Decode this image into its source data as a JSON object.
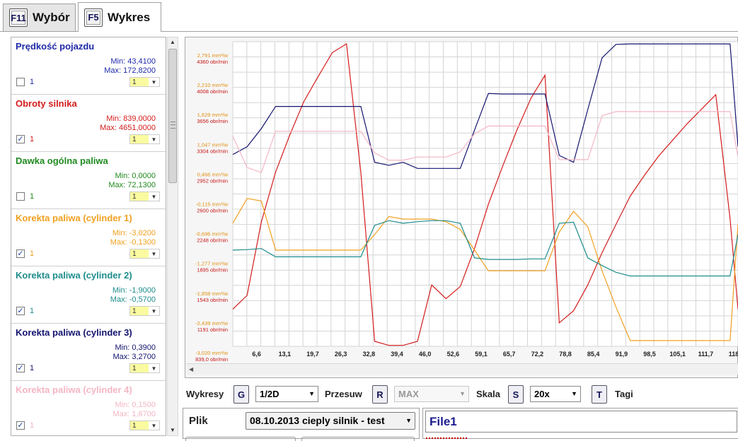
{
  "tabs": [
    {
      "key": "F11",
      "label": "Wybór",
      "active": false
    },
    {
      "key": "F5",
      "label": "Wykres",
      "active": true
    }
  ],
  "channels": [
    {
      "name": "Prędkość pojazdu",
      "color": "#1f2aa8",
      "min": "Min: 43,4100",
      "max": "Max: 172,8200",
      "checked": false,
      "check_label": "1",
      "select": "1"
    },
    {
      "name": "Obroty silnika",
      "color": "#d41c1c",
      "min": "Min: 839,0000",
      "max": "Max: 4651,0000",
      "checked": true,
      "check_label": "1",
      "select": "1"
    },
    {
      "name": "Dawka ogólna paliwa",
      "color": "#1f8a1f",
      "min": "Min: 0,0000",
      "max": "Max: 72,1300",
      "checked": false,
      "check_label": "1",
      "select": "1"
    },
    {
      "name": "Korekta paliwa (cylinder 1)",
      "color": "#f0a020",
      "min": "Min: -3,0200",
      "max": "Max: -0,1300",
      "checked": true,
      "check_label": "1",
      "select": "1"
    },
    {
      "name": "Korekta paliwa (cylinder 2)",
      "color": "#1e8c8c",
      "min": "Min: -1,9000",
      "max": "Max: -0,5700",
      "checked": true,
      "check_label": "1",
      "select": "1"
    },
    {
      "name": "Korekta paliwa (cylinder 3)",
      "color": "#141470",
      "min": "Min: 0,3900",
      "max": "Max: 3,2700",
      "checked": true,
      "check_label": "1",
      "select": "1"
    },
    {
      "name": "Korekta paliwa (cylinder 4)",
      "color": "#f4b6c4",
      "min": "Min: 0,1500",
      "max": "Max: 1,6700",
      "checked": true,
      "check_label": "1",
      "select": "1"
    }
  ],
  "controls": {
    "wykresy_label": "Wykresy",
    "wykresy_key": "G",
    "wykresy_value": "1/2D",
    "przesuw_label": "Przesuw",
    "przesuw_key": "R",
    "przesuw_value": "MAX",
    "skala_label": "Skala",
    "skala_key": "S",
    "skala_value": "20x",
    "tagi_key": "T",
    "tagi_label": "Tagi"
  },
  "file": {
    "plik_label": "Plik",
    "plik_value": "08.10.2013  cieply silnik - test",
    "file1_label": "File1"
  },
  "colors": {
    "series_cyl1": "#f0a020",
    "series_rpm": "#d41c1c",
    "series_cyl2": "#1e8c8c",
    "series_cyl3": "#141470",
    "series_cyl4": "#f4b6c4"
  },
  "chart_data": {
    "type": "line",
    "x_tick_labels": [
      "6,6",
      "13,1",
      "19,7",
      "26,3",
      "32,8",
      "39,4",
      "46,0",
      "52,6",
      "59,1",
      "65,7",
      "72,2",
      "78,8",
      "85,4",
      "91,9",
      "98,5",
      "105,1",
      "111,7",
      "118"
    ],
    "y_axis_mm_labels": [
      "2,791 mm³/w",
      "2,210 mm³/w",
      "1,629 mm³/w",
      "1,047 mm³/w",
      "0,466 mm³/w",
      "-0,115 mm³/w",
      "-0,696 mm³/w",
      "-1,277 mm³/w",
      "-1,858 mm³/w",
      "-2,439 mm³/w",
      "-3,020 mm³/w"
    ],
    "y_axis_rpm_labels": [
      "4360 obr/min",
      "4008 obr/min",
      "3656 obr/min",
      "3304 obr/min",
      "2952 obr/min",
      "2600 obr/min",
      "2248 obr/min",
      "1895 obr/min",
      "1543 obr/min",
      "1191 obr/min",
      "839,0 obr/min"
    ],
    "y_mm_range": [
      -3.02,
      2.791
    ],
    "x_range": [
      0,
      118
    ],
    "grid": true,
    "x": [
      0,
      3.3,
      6.6,
      9.9,
      13.1,
      16.4,
      19.7,
      23,
      26.3,
      29.6,
      32.8,
      36.1,
      39.4,
      42.7,
      46,
      49.3,
      52.6,
      55.9,
      59.1,
      62.4,
      65.7,
      69,
      72.2,
      75.5,
      78.8,
      82.1,
      85.4,
      88.6,
      91.9,
      95.2,
      98.5,
      101.8,
      105.1,
      108.4,
      111.7,
      115,
      118
    ],
    "series": [
      {
        "name": "Obroty silnika",
        "color": "#d41c1c",
        "values": [
          1300,
          1470,
          2380,
          3000,
          3450,
          3870,
          4180,
          4480,
          4590,
          3000,
          900,
          850,
          850,
          900,
          1600,
          1430,
          1580,
          2050,
          2600,
          3070,
          3520,
          3920,
          4200,
          1130,
          1280,
          1600,
          2000,
          2350,
          2700,
          2960,
          3200,
          3400,
          3600,
          3780,
          3960,
          2420,
          1300
        ]
      },
      {
        "name": "Korekta paliwa (cylinder 1)",
        "color": "#f0a020",
        "values": [
          -0.68,
          -0.2,
          -0.25,
          -1.2,
          -1.2,
          -1.2,
          -1.2,
          -1.2,
          -1.2,
          -1.2,
          -0.9,
          -0.55,
          -0.6,
          -0.6,
          -0.6,
          -0.65,
          -0.8,
          -1.2,
          -1.6,
          -1.6,
          -1.6,
          -1.6,
          -1.6,
          -0.85,
          -0.45,
          -0.75,
          -1.6,
          -2.3,
          -2.95,
          -2.95,
          -2.95,
          -2.95,
          -2.95,
          -2.95,
          -2.95,
          -2.95,
          -0.7
        ]
      },
      {
        "name": "Korekta paliwa (cylinder 2)",
        "color": "#1e8c8c",
        "values": [
          -1.2,
          -1.19,
          -1.17,
          -1.33,
          -1.33,
          -1.33,
          -1.33,
          -1.33,
          -1.33,
          -1.33,
          -0.72,
          -0.63,
          -0.68,
          -0.65,
          -0.63,
          -0.63,
          -0.68,
          -1.35,
          -1.38,
          -1.38,
          -1.38,
          -1.37,
          -1.37,
          -0.68,
          -0.66,
          -1.35,
          -1.5,
          -1.63,
          -1.7,
          -1.7,
          -1.7,
          -1.7,
          -1.7,
          -1.7,
          -1.7,
          -1.7,
          -0.9
        ]
      },
      {
        "name": "Korekta paliwa (cylinder 3)",
        "color": "#141470",
        "values": [
          0.65,
          0.8,
          1.15,
          1.58,
          1.58,
          1.58,
          1.58,
          1.58,
          1.58,
          1.58,
          0.5,
          0.44,
          0.5,
          0.38,
          0.38,
          0.38,
          0.38,
          1.12,
          1.83,
          1.82,
          1.82,
          1.82,
          1.82,
          0.63,
          0.5,
          1.52,
          2.52,
          2.78,
          2.79,
          2.79,
          2.79,
          2.79,
          2.79,
          2.79,
          2.79,
          2.79,
          0.8
        ]
      },
      {
        "name": "Korekta paliwa (cylinder 4)",
        "color": "#f4b6c4",
        "values": [
          1.0,
          0.4,
          0.3,
          1.1,
          1.1,
          1.1,
          1.1,
          1.1,
          1.1,
          1.1,
          0.68,
          0.54,
          0.54,
          0.6,
          0.6,
          0.6,
          0.7,
          1.05,
          1.2,
          1.2,
          1.2,
          1.2,
          1.2,
          0.55,
          0.55,
          0.55,
          1.4,
          1.48,
          1.48,
          1.48,
          1.48,
          1.48,
          1.48,
          1.48,
          1.48,
          1.48,
          0.6
        ]
      }
    ]
  }
}
